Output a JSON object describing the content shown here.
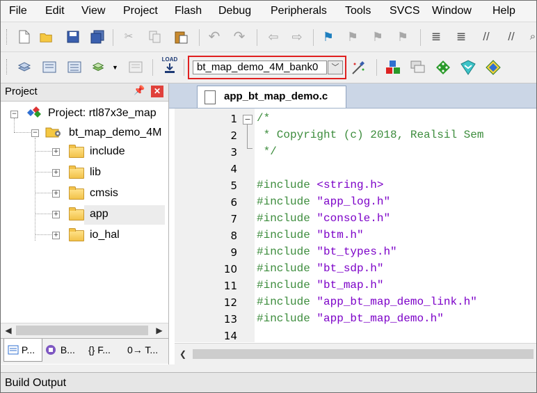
{
  "menubar": {
    "items": [
      "File",
      "Edit",
      "View",
      "Project",
      "Flash",
      "Debug",
      "Peripherals",
      "Tools",
      "SVCS",
      "Window",
      "Help"
    ]
  },
  "toolbar2": {
    "load_label": "LOAD",
    "target": "bt_map_demo_4M_bank0"
  },
  "project_panel": {
    "title": "Project",
    "pin_glyph": "ᵖ",
    "close_glyph": "✕",
    "root": "Project: rtl87x3e_map",
    "target": "bt_map_demo_4M",
    "groups": [
      "include",
      "lib",
      "cmsis",
      "app",
      "io_hal"
    ],
    "tabs": [
      "P...",
      "B...",
      "{} F...",
      "0→ T..."
    ]
  },
  "editor": {
    "tab": "app_bt_map_demo.c",
    "line_numbers": [
      "1",
      "2",
      "3",
      "4",
      "5",
      "6",
      "7",
      "8",
      "9",
      "10",
      "11",
      "12",
      "13",
      "14"
    ],
    "lines": {
      "l1": "/*",
      "l2": " * Copyright (c) 2018, Realsil Sem",
      "l3": " */",
      "inc": "#include",
      "l5": "<string.h>",
      "l6": "\"app_log.h\"",
      "l7": "\"console.h\"",
      "l8": "\"btm.h\"",
      "l9": "\"bt_types.h\"",
      "l10": "\"bt_sdp.h\"",
      "l11": "\"bt_map.h\"",
      "l12": "\"app_bt_map_demo_link.h\"",
      "l13": "\"app_bt_map_demo.h\""
    }
  },
  "status": {
    "label": "Build Output"
  }
}
